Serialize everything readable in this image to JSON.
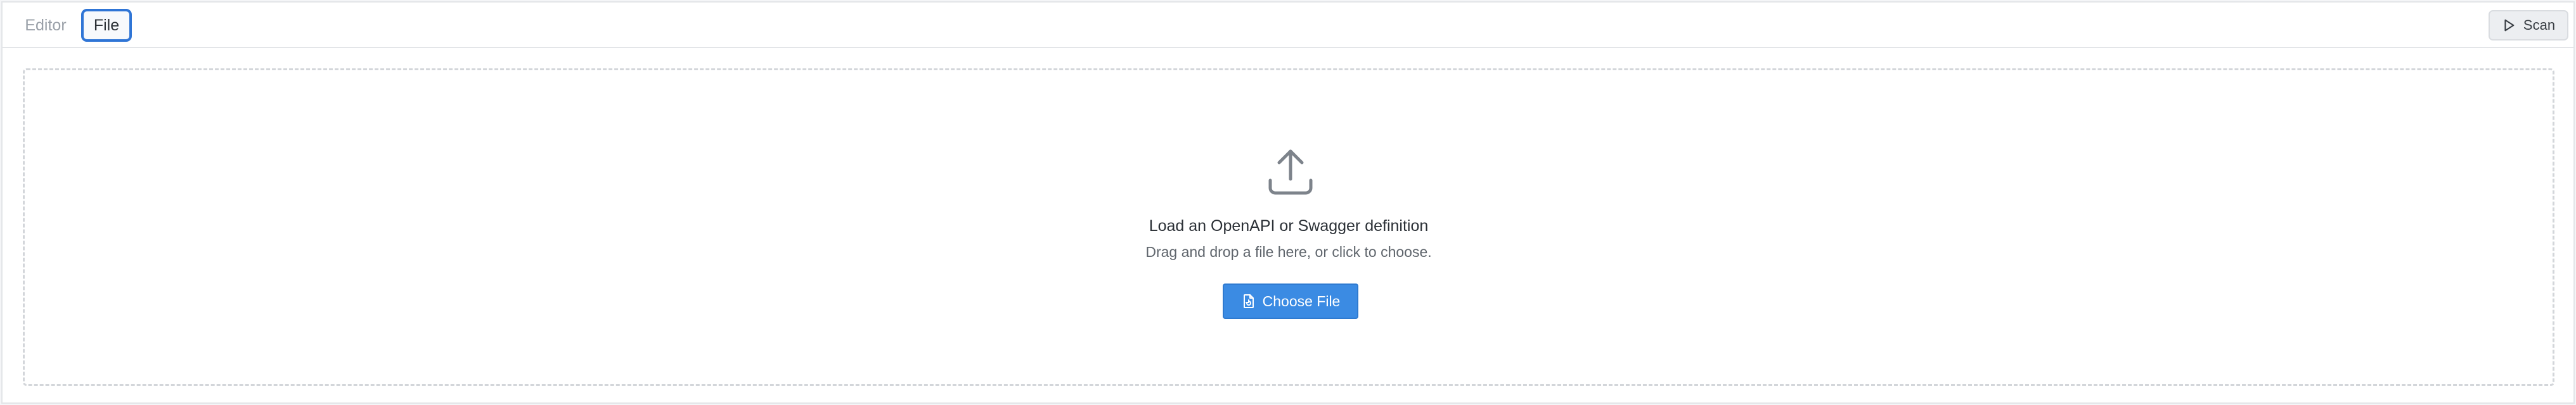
{
  "toolbar": {
    "tabs": [
      {
        "label": "Editor",
        "active": false
      },
      {
        "label": "File",
        "active": true
      }
    ],
    "scan_label": "Scan",
    "scan_icon": "play-icon"
  },
  "dropzone": {
    "icon": "upload-icon",
    "title": "Load an OpenAPI or Swagger definition",
    "subtitle": "Drag and drop a file here, or click to choose.",
    "button_label": "Choose File",
    "button_icon": "file-icon"
  },
  "colors": {
    "accent": "#3b8be3",
    "active_tab_border": "#2f75d6",
    "dashed_border": "#d3d6da"
  }
}
